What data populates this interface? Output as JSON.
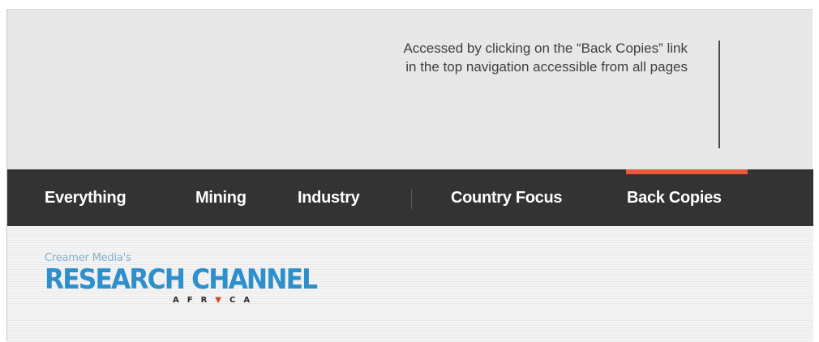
{
  "annotation": {
    "line1": "Accessed by clicking on the “Back Copies” link",
    "line2": "in the top navigation accessible from all pages"
  },
  "nav": {
    "items": [
      {
        "label": "Everything"
      },
      {
        "label": "Mining"
      },
      {
        "label": "Industry"
      },
      {
        "label": "Country Focus"
      },
      {
        "label": "Back Copies",
        "active": true
      }
    ]
  },
  "logo": {
    "small": "Creamer Media's",
    "main": "RESEARCH CHANNEL",
    "sub_before": "AFR",
    "sub_mark": "▼",
    "sub_after": "CA"
  },
  "colors": {
    "nav_bg": "#333333",
    "active_indicator": "#e8583a",
    "logo_blue": "#2d8fcb",
    "logo_light_blue": "#7fb0d3",
    "africa_red": "#d7442a"
  }
}
